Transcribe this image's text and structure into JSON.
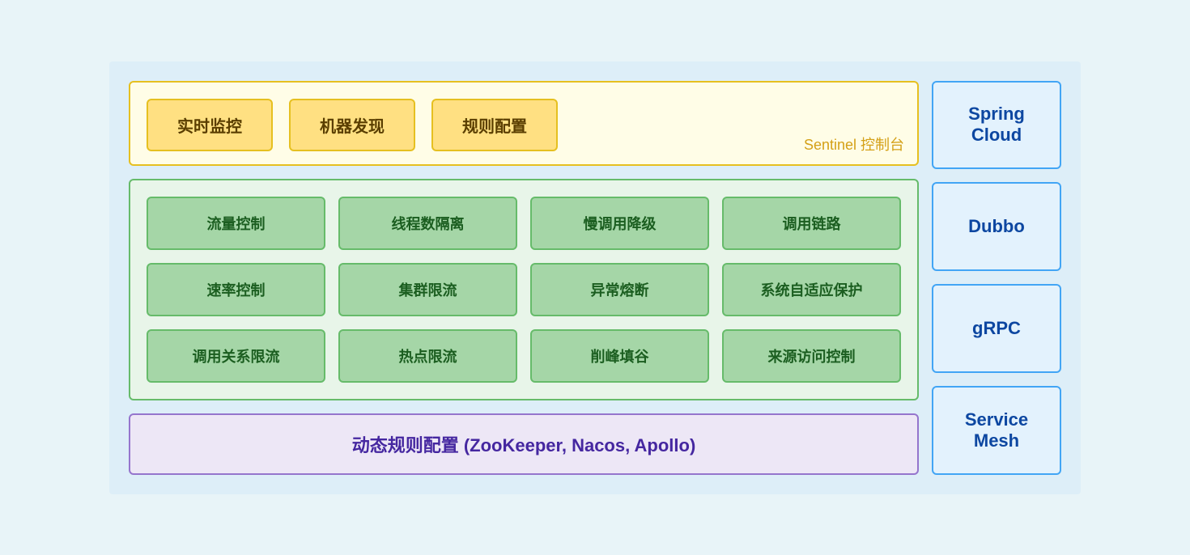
{
  "sentinel": {
    "label": "Sentinel 控制台",
    "items": [
      {
        "id": "realtime-monitor",
        "text": "实时监控"
      },
      {
        "id": "machine-discovery",
        "text": "机器发现"
      },
      {
        "id": "rule-config",
        "text": "规则配置"
      }
    ]
  },
  "core": {
    "items": [
      {
        "id": "flow-control",
        "text": "流量控制"
      },
      {
        "id": "thread-isolation",
        "text": "线程数隔离"
      },
      {
        "id": "slow-degradation",
        "text": "慢调用降级"
      },
      {
        "id": "call-chain",
        "text": "调用链路"
      },
      {
        "id": "rate-control",
        "text": "速率控制"
      },
      {
        "id": "cluster-limit",
        "text": "集群限流"
      },
      {
        "id": "exception-breaker",
        "text": "异常熔断"
      },
      {
        "id": "system-protection",
        "text": "系统自适应保护"
      },
      {
        "id": "call-relation-limit",
        "text": "调用关系限流"
      },
      {
        "id": "hotspot-limit",
        "text": "热点限流"
      },
      {
        "id": "peak-fill",
        "text": "削峰填谷"
      },
      {
        "id": "source-access-control",
        "text": "来源访问控制"
      }
    ]
  },
  "dynamic": {
    "text": "动态规则配置 (ZooKeeper, Nacos, Apollo)"
  },
  "right_panel": {
    "items": [
      {
        "id": "spring-cloud",
        "text": "Spring Cloud"
      },
      {
        "id": "dubbo",
        "text": "Dubbo"
      },
      {
        "id": "grpc",
        "text": "gRPC"
      },
      {
        "id": "service-mesh",
        "text": "Service Mesh"
      }
    ]
  }
}
